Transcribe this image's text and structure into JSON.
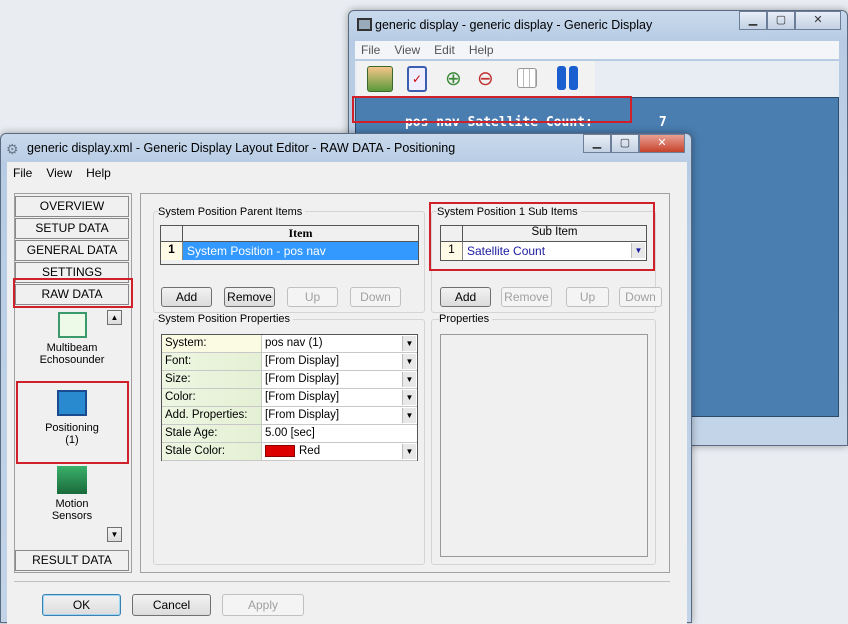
{
  "back_window": {
    "title": "generic display - generic display  - Generic Display",
    "menu": [
      "File",
      "View",
      "Edit",
      "Help"
    ],
    "toolbar_icons": [
      "user-icon",
      "checklist-icon",
      "zoom-in-icon",
      "zoom-out-icon",
      "grid-icon",
      "pause-icon"
    ],
    "display_label": "pos nav Satellite Count:",
    "display_value": "7",
    "display_color": "#4a7db0"
  },
  "front_window": {
    "title": "generic display.xml - Generic Display Layout Editor -  RAW DATA -  Positioning",
    "menu": [
      "File",
      "View",
      "Help"
    ],
    "nav": [
      "OVERVIEW",
      "SETUP DATA",
      "GENERAL DATA",
      "SETTINGS",
      "RAW DATA",
      "RESULT DATA"
    ],
    "sensors": [
      {
        "label1": "Multibeam",
        "label2": "Echosounder"
      },
      {
        "label1": "Positioning",
        "label2": "(1)"
      },
      {
        "label1": "Motion",
        "label2": "Sensors"
      }
    ],
    "parent_items": {
      "title": "System Position Parent Items",
      "header": "Item",
      "rows": [
        {
          "index": "1",
          "value": "System Position  -  pos nav"
        }
      ],
      "buttons": [
        "Add",
        "Remove",
        "Up",
        "Down"
      ]
    },
    "sub_items": {
      "title": "System Position 1 Sub Items",
      "header": "Sub Item",
      "rows": [
        {
          "index": "1",
          "value": "Satellite Count"
        }
      ],
      "buttons": [
        "Add",
        "Remove",
        "Up",
        "Down"
      ]
    },
    "properties": {
      "title": "System Position Properties",
      "rows": [
        {
          "key": "System:",
          "value": "pos nav (1)"
        },
        {
          "key": "Font:",
          "value": "[From Display]"
        },
        {
          "key": "Size:",
          "value": "[From Display]"
        },
        {
          "key": "Color:",
          "value": "[From Display]"
        },
        {
          "key": "Add. Properties:",
          "value": "[From Display]"
        },
        {
          "key": "Stale Age:",
          "value": "5.00 [sec]"
        },
        {
          "key": "Stale Color:",
          "value": "Red",
          "swatch": "#dd0000"
        }
      ]
    },
    "sub_properties_title": "Properties",
    "footer": {
      "ok": "OK",
      "cancel": "Cancel",
      "apply": "Apply"
    }
  }
}
